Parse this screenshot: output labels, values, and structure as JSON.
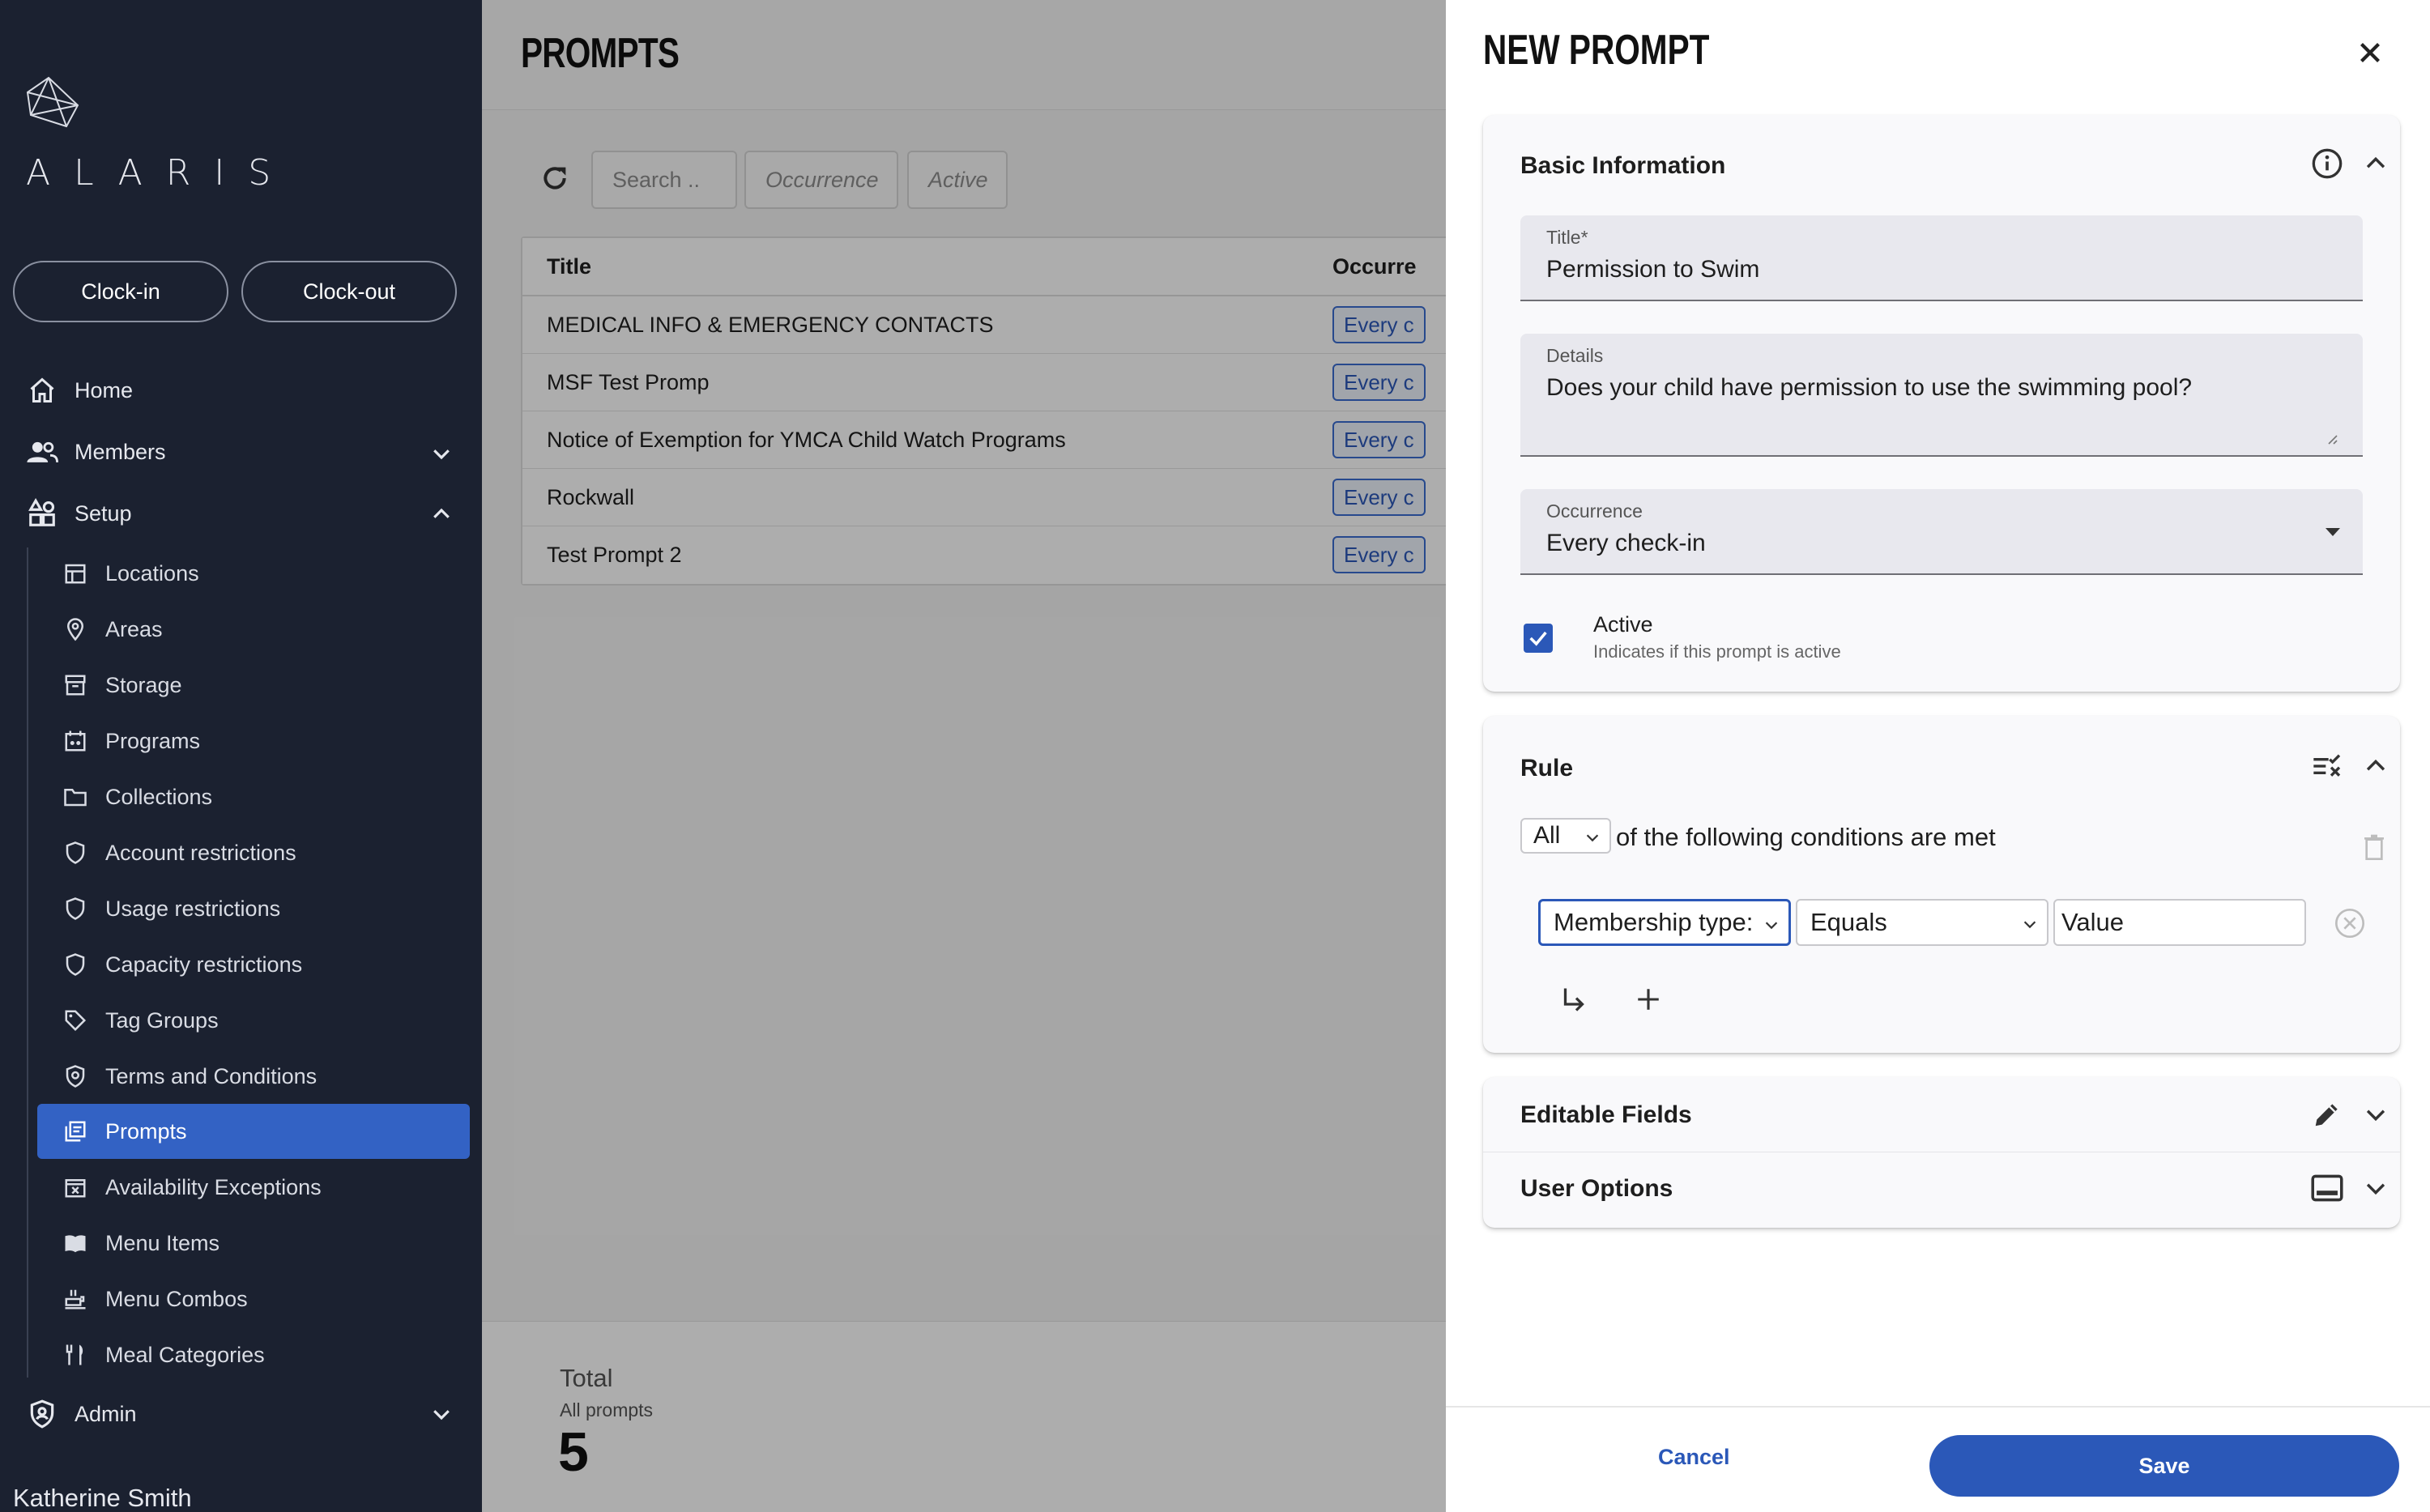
{
  "sidebar": {
    "logo_text": "ALARIS",
    "clock_in": "Clock-in",
    "clock_out": "Clock-out",
    "items": [
      {
        "label": "Home",
        "icon": "home-icon"
      },
      {
        "label": "Members",
        "icon": "members-icon",
        "expanded": false
      },
      {
        "label": "Setup",
        "icon": "setup-icon",
        "expanded": true
      },
      {
        "label": "Admin",
        "icon": "admin-icon",
        "expanded": false
      }
    ],
    "setup_items": [
      {
        "label": "Locations",
        "icon": "locations-icon"
      },
      {
        "label": "Areas",
        "icon": "map-pin-icon"
      },
      {
        "label": "Storage",
        "icon": "storage-icon"
      },
      {
        "label": "Programs",
        "icon": "programs-icon"
      },
      {
        "label": "Collections",
        "icon": "folder-icon"
      },
      {
        "label": "Account restrictions",
        "icon": "shield-icon"
      },
      {
        "label": "Usage restrictions",
        "icon": "shield-icon"
      },
      {
        "label": "Capacity restrictions",
        "icon": "shield-icon"
      },
      {
        "label": "Tag Groups",
        "icon": "tag-icon"
      },
      {
        "label": "Terms and Conditions",
        "icon": "terms-icon"
      },
      {
        "label": "Prompts",
        "icon": "prompts-icon",
        "active": true
      },
      {
        "label": "Availability Exceptions",
        "icon": "calendar-x-icon"
      },
      {
        "label": "Menu Items",
        "icon": "menu-book-icon"
      },
      {
        "label": "Menu Combos",
        "icon": "menu-combos-icon"
      },
      {
        "label": "Meal Categories",
        "icon": "fork-knife-icon"
      }
    ],
    "user_name": "Katherine Smith"
  },
  "main": {
    "title": "PROMPTS",
    "filters": {
      "search_placeholder": "Search ..",
      "occurrence": "Occurrence",
      "active": "Active"
    },
    "table": {
      "headers": [
        "Title",
        "Occurre"
      ],
      "rows": [
        {
          "title": "MEDICAL INFO & EMERGENCY CONTACTS",
          "occurrence": "Every c"
        },
        {
          "title": "MSF Test Promp",
          "occurrence": "Every c"
        },
        {
          "title": "Notice of Exemption for YMCA Child Watch Programs",
          "occurrence": "Every c"
        },
        {
          "title": "Rockwall",
          "occurrence": "Every c"
        },
        {
          "title": "Test Prompt 2",
          "occurrence": "Every c"
        }
      ]
    },
    "total": {
      "label": "Total",
      "sub": "All prompts",
      "value": "5"
    }
  },
  "drawer": {
    "title": "NEW PROMPT",
    "basic": {
      "heading": "Basic Information",
      "title_label": "Title*",
      "title_value": "Permission to Swim",
      "details_label": "Details",
      "details_value": "Does your child have permission to use the swimming pool?",
      "occurrence_label": "Occurrence",
      "occurrence_value": "Every check-in",
      "active_label": "Active",
      "active_sub": "Indicates if this prompt is active",
      "active_checked": true
    },
    "rule": {
      "heading": "Rule",
      "match": "All",
      "match_text": "of the following conditions are met",
      "field": "Membership type:",
      "operator": "Equals",
      "value_placeholder": "Value"
    },
    "editable_fields": "Editable Fields",
    "user_options": "User Options",
    "cancel": "Cancel",
    "save": "Save"
  },
  "colors": {
    "sidebar_bg": "#1b2130",
    "accent": "#2b58b8",
    "active_nav": "#3362c4"
  }
}
